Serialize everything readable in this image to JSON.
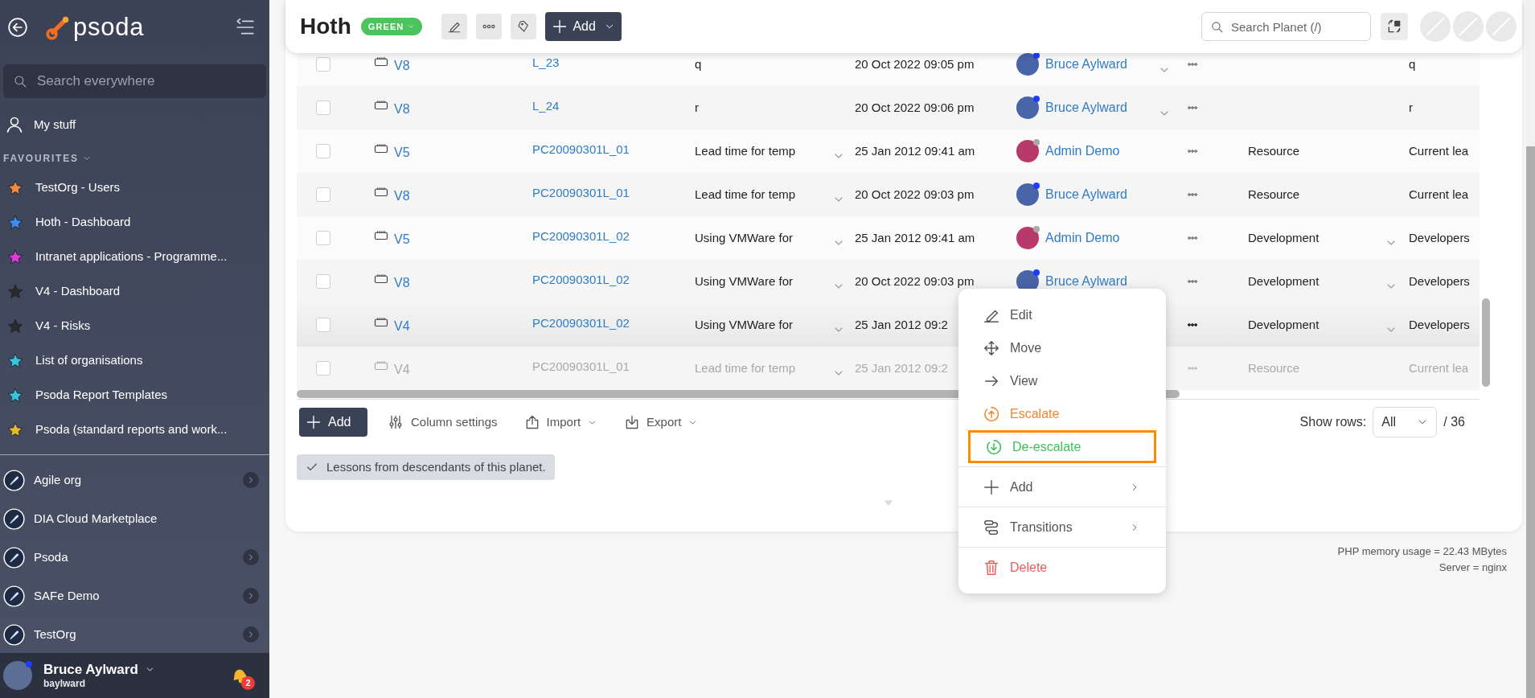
{
  "sidebar": {
    "logo": "psoda",
    "search": {
      "placeholder": "Search everywhere"
    },
    "my_stuff": "My stuff",
    "favourites_heading": "FAVOURITES",
    "favourites": [
      {
        "label": "TestOrg - Users",
        "color": "#f28b3c"
      },
      {
        "label": "Hoth - Dashboard",
        "color": "#3d8ef0"
      },
      {
        "label": "Intranet applications - Programme...",
        "color": "#e03ad6"
      },
      {
        "label": "V4 - Dashboard",
        "color": "#2a2a2a"
      },
      {
        "label": "V4 - Risks",
        "color": "#2a2a2a"
      },
      {
        "label": "List of organisations",
        "color": "#35c5dc"
      },
      {
        "label": "Psoda Report Templates",
        "color": "#35c5dc"
      },
      {
        "label": "Psoda (standard reports and work...",
        "color": "#e5bb27"
      }
    ],
    "planets": [
      {
        "label": "Agile org",
        "has_children": true
      },
      {
        "label": "DIA Cloud Marketplace",
        "has_children": false
      },
      {
        "label": "Psoda",
        "has_children": true
      },
      {
        "label": "SAFe Demo",
        "has_children": true
      },
      {
        "label": "TestOrg",
        "has_children": true
      }
    ],
    "user": {
      "name": "Bruce Aylward",
      "username": "baylward",
      "online": true,
      "notifications": "2"
    }
  },
  "header": {
    "title": "Hoth",
    "status": "GREEN",
    "add_button": "Add",
    "search": {
      "placeholder": "Search Planet (/)"
    }
  },
  "table": {
    "rows": [
      {
        "selected": false,
        "version": "V8",
        "ref": "L_23",
        "title": "q",
        "title_expandable": false,
        "date": "20 Oct 2022 09:05 pm",
        "owner": "Bruce Aylward",
        "owner_online": true,
        "owner_expandable": true,
        "description": "q",
        "highlighted": false,
        "dimmed": false
      },
      {
        "selected": false,
        "version": "V8",
        "ref": "L_24",
        "title": "r",
        "title_expandable": false,
        "date": "20 Oct 2022 09:06 pm",
        "owner": "Bruce Aylward",
        "owner_online": true,
        "owner_expandable": true,
        "description": "r",
        "highlighted": false,
        "dimmed": false
      },
      {
        "selected": false,
        "version": "V5",
        "ref": "PC20090301L_01",
        "title": "Lead time for temp",
        "title_expandable": true,
        "date": "25 Jan 2012 09:41 am",
        "owner": "Admin Demo",
        "owner_online": false,
        "owner_expandable": false,
        "category": "Resource",
        "category_expandable": false,
        "description": "Current lea",
        "highlighted": false,
        "dimmed": false
      },
      {
        "selected": false,
        "version": "V8",
        "ref": "PC20090301L_01",
        "title": "Lead time for temp",
        "title_expandable": true,
        "date": "20 Oct 2022 09:03 pm",
        "owner": "Bruce Aylward",
        "owner_online": true,
        "owner_expandable": false,
        "category": "Resource",
        "category_expandable": false,
        "description": "Current lea",
        "highlighted": false,
        "dimmed": false
      },
      {
        "selected": false,
        "version": "V5",
        "ref": "PC20090301L_02",
        "title": "Using VMWare for",
        "title_expandable": true,
        "date": "25 Jan 2012 09:41 am",
        "owner": "Admin Demo",
        "owner_online": false,
        "owner_expandable": false,
        "category": "Development",
        "category_expandable": true,
        "description": "Developers",
        "highlighted": false,
        "dimmed": false
      },
      {
        "selected": false,
        "version": "V8",
        "ref": "PC20090301L_02",
        "title": "Using VMWare for",
        "title_expandable": true,
        "date": "20 Oct 2022 09:03 pm",
        "owner": "Bruce Aylward",
        "owner_online": true,
        "owner_expandable": false,
        "category": "Development",
        "category_expandable": true,
        "description": "Developers",
        "highlighted": false,
        "dimmed": false
      },
      {
        "selected": false,
        "version": "V4",
        "ref": "PC20090301L_02",
        "title": "Using VMWare for",
        "title_expandable": true,
        "date": "25 Jan 2012 09:2",
        "category": "Development",
        "category_expandable": true,
        "description": "Developers",
        "highlighted": true,
        "dimmed": false
      },
      {
        "selected": false,
        "version": "V4",
        "ref": "PC20090301L_01",
        "title": "Lead time for temp",
        "title_expandable": true,
        "date": "25 Jan 2012 09:2",
        "category": "Resource",
        "category_expandable": false,
        "description": "Current lea",
        "highlighted": false,
        "dimmed": true
      }
    ]
  },
  "toolbar": {
    "add": "Add",
    "column_settings": "Column settings",
    "import": "Import",
    "export": "Export",
    "show_rows_label": "Show rows:",
    "show_rows_value": "All",
    "total": "/ 36"
  },
  "filter_tag": "Lessons from descendants of this planet.",
  "context_menu": {
    "groups": [
      {
        "items": [
          {
            "label": "Edit",
            "kind": "neutral",
            "submenu": false,
            "highlighted": false
          },
          {
            "label": "Move",
            "kind": "neutral",
            "submenu": false,
            "highlighted": false
          },
          {
            "label": "View",
            "kind": "neutral",
            "submenu": false,
            "highlighted": false
          },
          {
            "label": "Escalate",
            "kind": "warning",
            "submenu": false,
            "highlighted": false
          },
          {
            "label": "De-escalate",
            "kind": "success",
            "submenu": false,
            "highlighted": true
          }
        ]
      },
      {
        "items": [
          {
            "label": "Add",
            "kind": "neutral",
            "submenu": true,
            "highlighted": false
          }
        ]
      },
      {
        "items": [
          {
            "label": "Transitions",
            "kind": "neutral",
            "submenu": true,
            "highlighted": false
          }
        ]
      },
      {
        "items": [
          {
            "label": "Delete",
            "kind": "danger",
            "submenu": false,
            "highlighted": false
          }
        ]
      }
    ]
  },
  "footer": [
    "PHP memory usage = 22.43 MBytes",
    "Server = nginx"
  ]
}
